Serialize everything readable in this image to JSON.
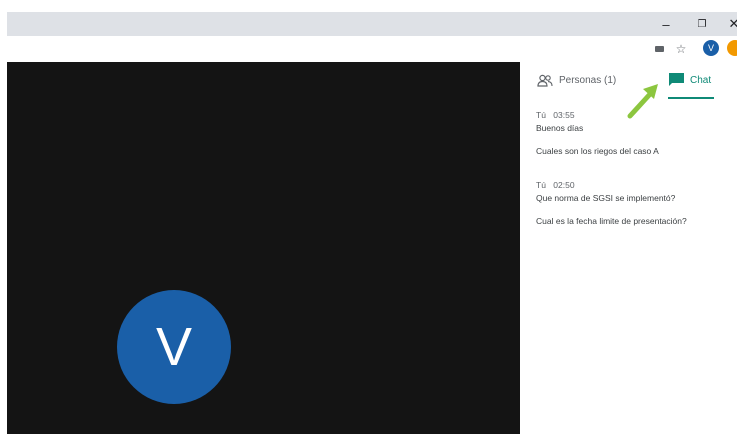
{
  "window": {
    "controls": {
      "minimize": "–",
      "restore": "❐",
      "close": "✕"
    }
  },
  "toolbar": {
    "icons": [
      "extension-icon",
      "star-icon"
    ],
    "profile_initial": "V",
    "colors": {
      "profile": "#1a5fa8",
      "extension_badge": "#f29900"
    }
  },
  "video": {
    "participant_initial": "V",
    "background": "#141414",
    "avatar_color": "#1a5fa8"
  },
  "panel": {
    "tabs": [
      {
        "label": "Personas (1)",
        "icon": "people-icon",
        "active": false
      },
      {
        "label": "Chat",
        "icon": "chat-icon",
        "active": true
      }
    ],
    "accent": "#0f8a77",
    "messages": [
      {
        "sender": "Tú",
        "time": "03:55",
        "lines": [
          "Buenos días",
          "Cuales son los riegos del caso A"
        ]
      },
      {
        "sender": "Tú",
        "time": "02:50",
        "lines": [
          "Que norma de SGSI se implementó?",
          "Cual es la fecha limite de presentación?"
        ]
      }
    ]
  },
  "annotation": {
    "arrow_color": "#8cc63f"
  }
}
